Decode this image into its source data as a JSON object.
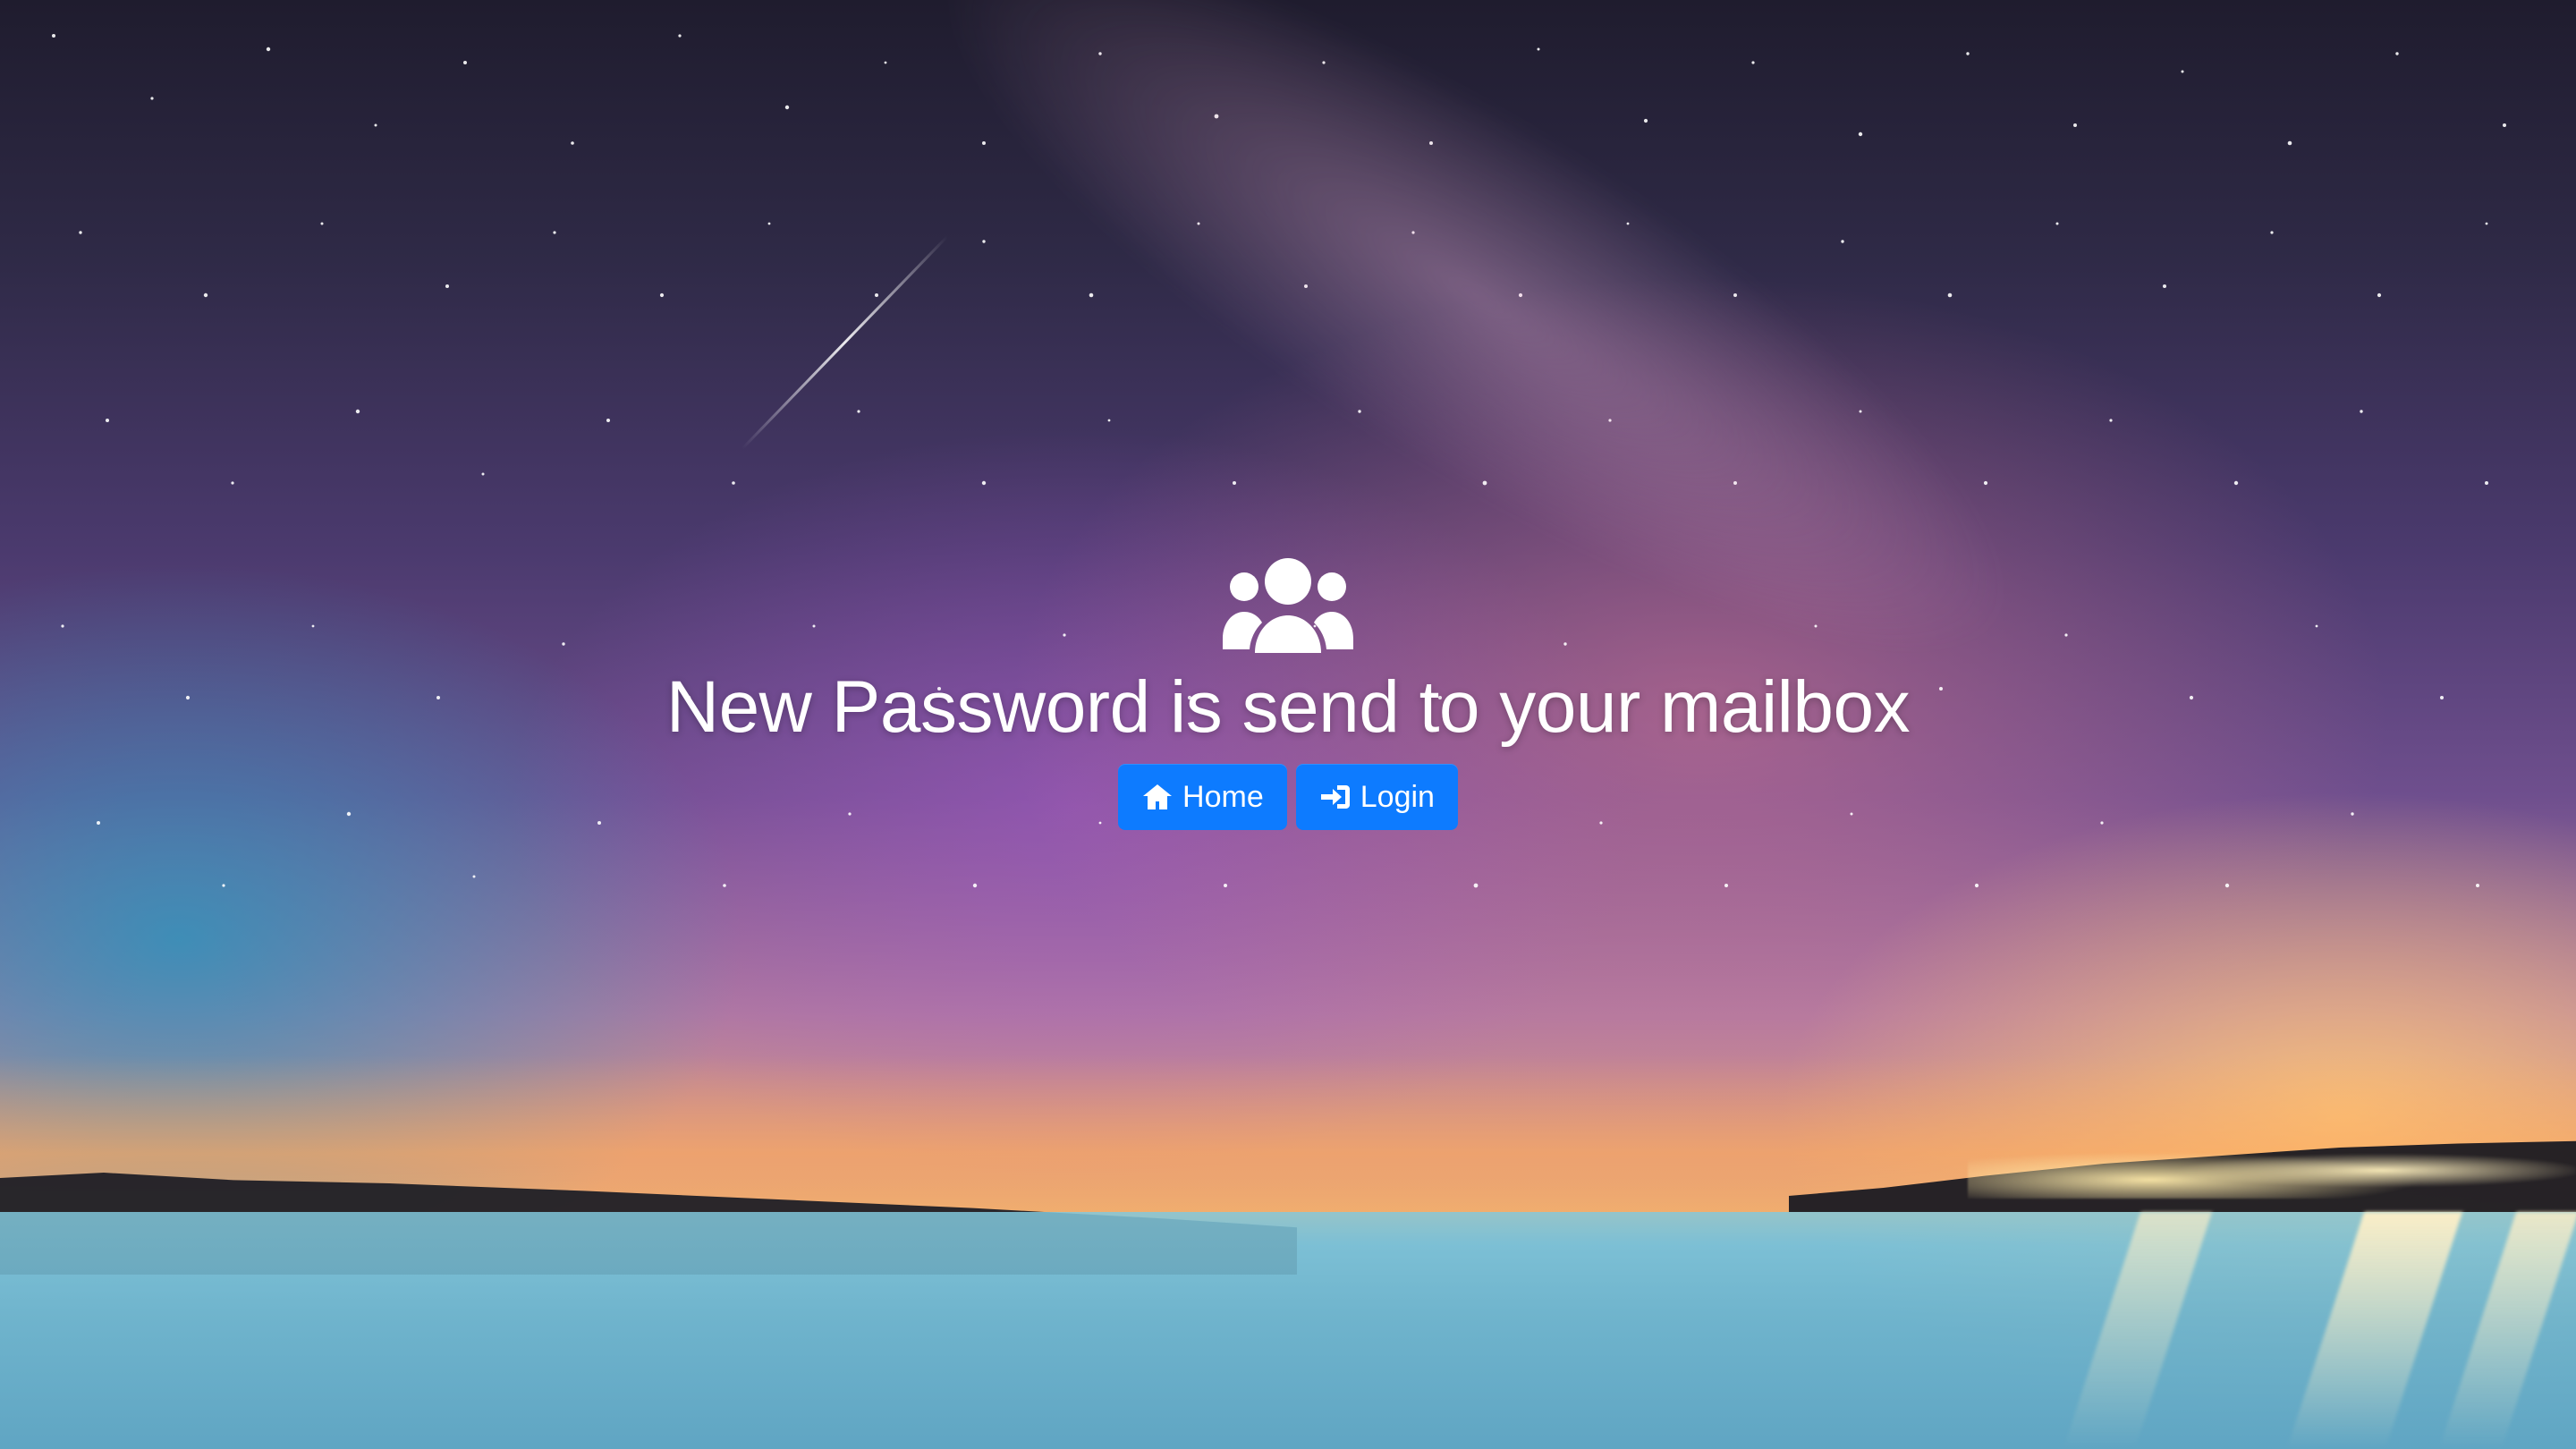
{
  "page": {
    "icon": "users-icon",
    "message": "New Password is send to your mailbox"
  },
  "actions": {
    "home": {
      "label": "Home",
      "icon": "home-icon"
    },
    "login": {
      "label": "Login",
      "icon": "sign-in-icon"
    }
  },
  "colors": {
    "button": "#0d7bff",
    "text": "#ffffff"
  }
}
